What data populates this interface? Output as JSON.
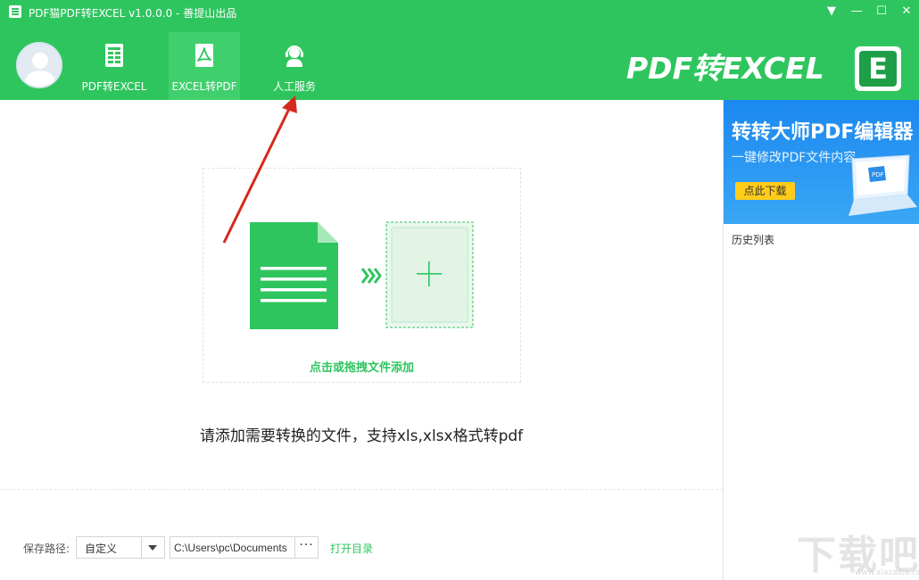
{
  "window": {
    "title": "PDF猫PDF转EXCEL v1.0.0.0 - 善提山出品",
    "controls": [
      "▼",
      "—",
      "☐",
      "✕"
    ]
  },
  "nav": {
    "items": [
      {
        "label": "PDF转EXCEL",
        "icon": "spreadsheet-icon"
      },
      {
        "label": "EXCEL转PDF",
        "icon": "pdf-icon"
      },
      {
        "label": "人工服务",
        "icon": "customer-service-icon"
      }
    ]
  },
  "brand": {
    "text": "PDF转EXCEL",
    "logo_letter": "E"
  },
  "dropzone": {
    "label": "点击或拖拽文件添加"
  },
  "hint": "请添加需要转换的文件，支持xls,xlsx格式转pdf",
  "save": {
    "label": "保存路径:",
    "mode": "自定义",
    "path": "C:\\Users\\pc\\Documents",
    "more": "···",
    "open_dir": "打开目录"
  },
  "sidebar": {
    "ad": {
      "title": "转转大师PDF编辑器",
      "subtitle": "一键修改PDF文件内容",
      "button": "点此下载",
      "laptop_label": "PDF"
    },
    "history_title": "历史列表"
  },
  "watermark": {
    "text": "下载吧",
    "url": "www.xiazaiba.com"
  },
  "colors": {
    "brand_green": "#2fc55e",
    "active_tab": "#3fd06d",
    "ad_blue": "#1b88f0",
    "ad_button": "#ffcc1a",
    "arrow_red": "#d42a1e"
  }
}
